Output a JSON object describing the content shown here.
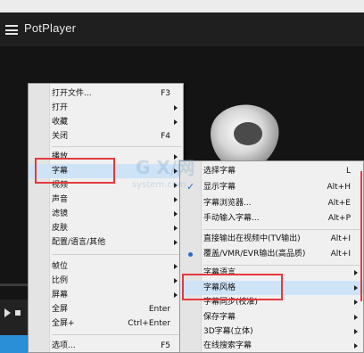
{
  "app": {
    "title": "PotPlayer"
  },
  "colors": {
    "accent_red": "#e4393c",
    "highlight": "#cfe3f7",
    "check_blue": "#2a6cc4"
  },
  "icons": [
    "hamburger-icon",
    "play-icon",
    "stop-icon",
    "submenu-arrow-icon",
    "check-icon",
    "radio-dot-icon"
  ],
  "main_menu": {
    "items": [
      {
        "label": "打开文件...",
        "shortcut": "F3"
      },
      {
        "label": "打开",
        "shortcut": ""
      },
      {
        "label": "收藏",
        "shortcut": ""
      },
      {
        "label": "关闭",
        "shortcut": "F4"
      },
      {
        "label": "播放",
        "shortcut": ""
      },
      {
        "label": "字幕",
        "shortcut": ""
      },
      {
        "label": "视频",
        "shortcut": ""
      },
      {
        "label": "声音",
        "shortcut": ""
      },
      {
        "label": "滤镜",
        "shortcut": ""
      },
      {
        "label": "皮肤",
        "shortcut": ""
      },
      {
        "label": "配置/语言/其他",
        "shortcut": ""
      },
      {
        "label": "帧位",
        "shortcut": ""
      },
      {
        "label": "比例",
        "shortcut": ""
      },
      {
        "label": "屏幕",
        "shortcut": ""
      },
      {
        "label": "全屏",
        "shortcut": "Enter"
      },
      {
        "label": "全屏+",
        "shortcut": "Ctrl+Enter"
      },
      {
        "label": "选项...",
        "shortcut": "F5"
      }
    ]
  },
  "subtitle_menu": {
    "items": [
      {
        "label": "选择字幕",
        "shortcut": "L"
      },
      {
        "label": "显示字幕",
        "shortcut": "Alt+H"
      },
      {
        "label": "字幕浏览器...",
        "shortcut": "Alt+E"
      },
      {
        "label": "手动输入字幕...",
        "shortcut": "Alt+P"
      },
      {
        "label": "直接输出在视频中(TV输出)",
        "shortcut": "Alt+I"
      },
      {
        "label": "覆盖/VMR/EVR输出(高品质)",
        "shortcut": "Alt+I"
      },
      {
        "label": "字幕语言",
        "shortcut": ""
      },
      {
        "label": "字幕风格",
        "shortcut": ""
      },
      {
        "label": "字幕同步(校准)",
        "shortcut": ""
      },
      {
        "label": "保存字幕",
        "shortcut": ""
      },
      {
        "label": "3D字幕(立体)",
        "shortcut": ""
      },
      {
        "label": "在线搜索字幕",
        "shortcut": ""
      }
    ]
  },
  "watermark": {
    "text": "G X/网",
    "url": "system.com"
  }
}
